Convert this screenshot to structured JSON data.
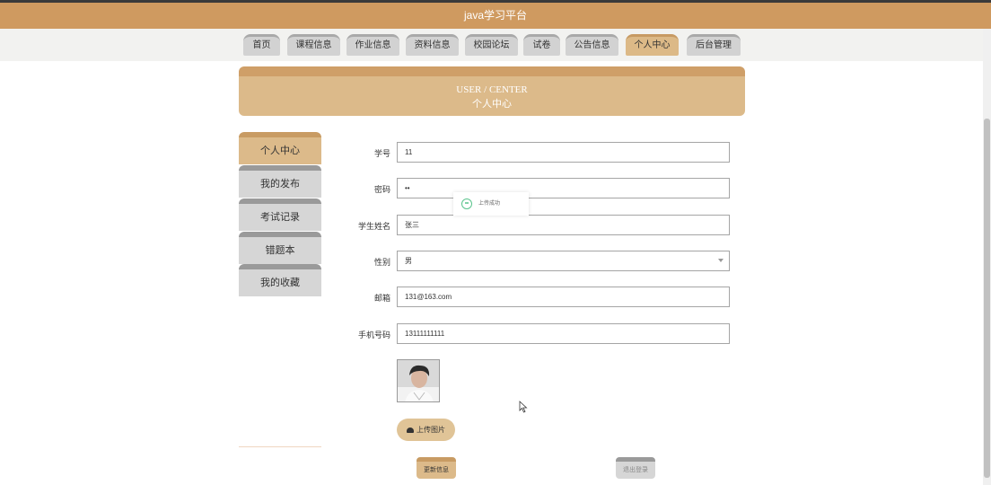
{
  "header": {
    "title": "java学习平台"
  },
  "nav": {
    "items": [
      {
        "label": "首页"
      },
      {
        "label": "课程信息"
      },
      {
        "label": "作业信息"
      },
      {
        "label": "资料信息"
      },
      {
        "label": "校园论坛"
      },
      {
        "label": "试卷"
      },
      {
        "label": "公告信息"
      },
      {
        "label": "个人中心"
      },
      {
        "label": "后台管理"
      }
    ],
    "active_index": 7
  },
  "banner": {
    "en": "USER / CENTER",
    "cn": "个人中心"
  },
  "sidebar": {
    "items": [
      {
        "label": "个人中心"
      },
      {
        "label": "我的发布"
      },
      {
        "label": "考试记录"
      },
      {
        "label": "错题本"
      },
      {
        "label": "我的收藏"
      }
    ],
    "active_index": 0
  },
  "form": {
    "student_id": {
      "label": "学号",
      "value": "11"
    },
    "password": {
      "label": "密码",
      "value": "••"
    },
    "student_name": {
      "label": "学生姓名",
      "value": "张三"
    },
    "gender": {
      "label": "性别",
      "value": "男"
    },
    "email": {
      "label": "邮箱",
      "value": "131@163.com"
    },
    "phone": {
      "label": "手机号码",
      "value": "13111111111"
    }
  },
  "toast": {
    "message": "上传成功"
  },
  "buttons": {
    "upload": "上传图片",
    "update": "更新信息",
    "logout": "退出登录"
  },
  "colors": {
    "accent": "#cf9a60",
    "accent_light": "#dcba8a",
    "inactive": "#d6d6d6",
    "toast_icon": "#5bc48d"
  },
  "icons": {
    "upload": "cloud-upload-icon",
    "toast": "smile-icon",
    "select": "chevron-down-icon"
  }
}
